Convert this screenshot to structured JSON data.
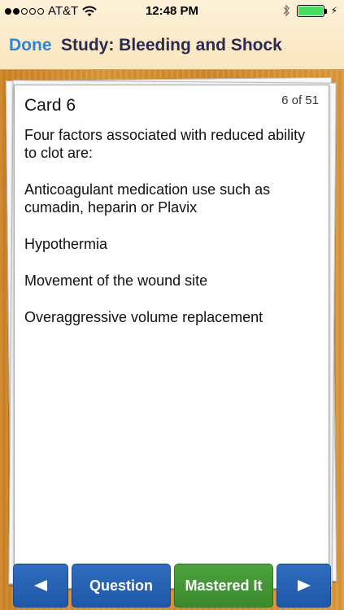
{
  "status_bar": {
    "carrier": "AT&T",
    "time": "12:48 PM",
    "signal_bars_filled": 2,
    "signal_bars_total": 5,
    "battery_level": 1.0
  },
  "navbar": {
    "done_label": "Done",
    "title": "Study: Bleeding and Shock"
  },
  "card": {
    "title": "Card 6",
    "count": "6 of 51",
    "paragraphs": [
      "Four factors associated with reduced ability to clot are:",
      "Anticoagulant medication use such as cumadin, heparin or Plavix",
      "Hypothermia",
      "Movement of the wound site",
      "Overaggressive volume replacement"
    ]
  },
  "toolbar": {
    "prev_icon": "arrow-left-icon",
    "question_label": "Question",
    "mastered_label": "Mastered It",
    "next_icon": "arrow-right-icon"
  },
  "colors": {
    "nav_link": "#2a86d8",
    "nav_title": "#2a2a52",
    "button_blue": "#1f58a8",
    "button_green": "#3b8a2e",
    "battery": "#4cd964"
  }
}
